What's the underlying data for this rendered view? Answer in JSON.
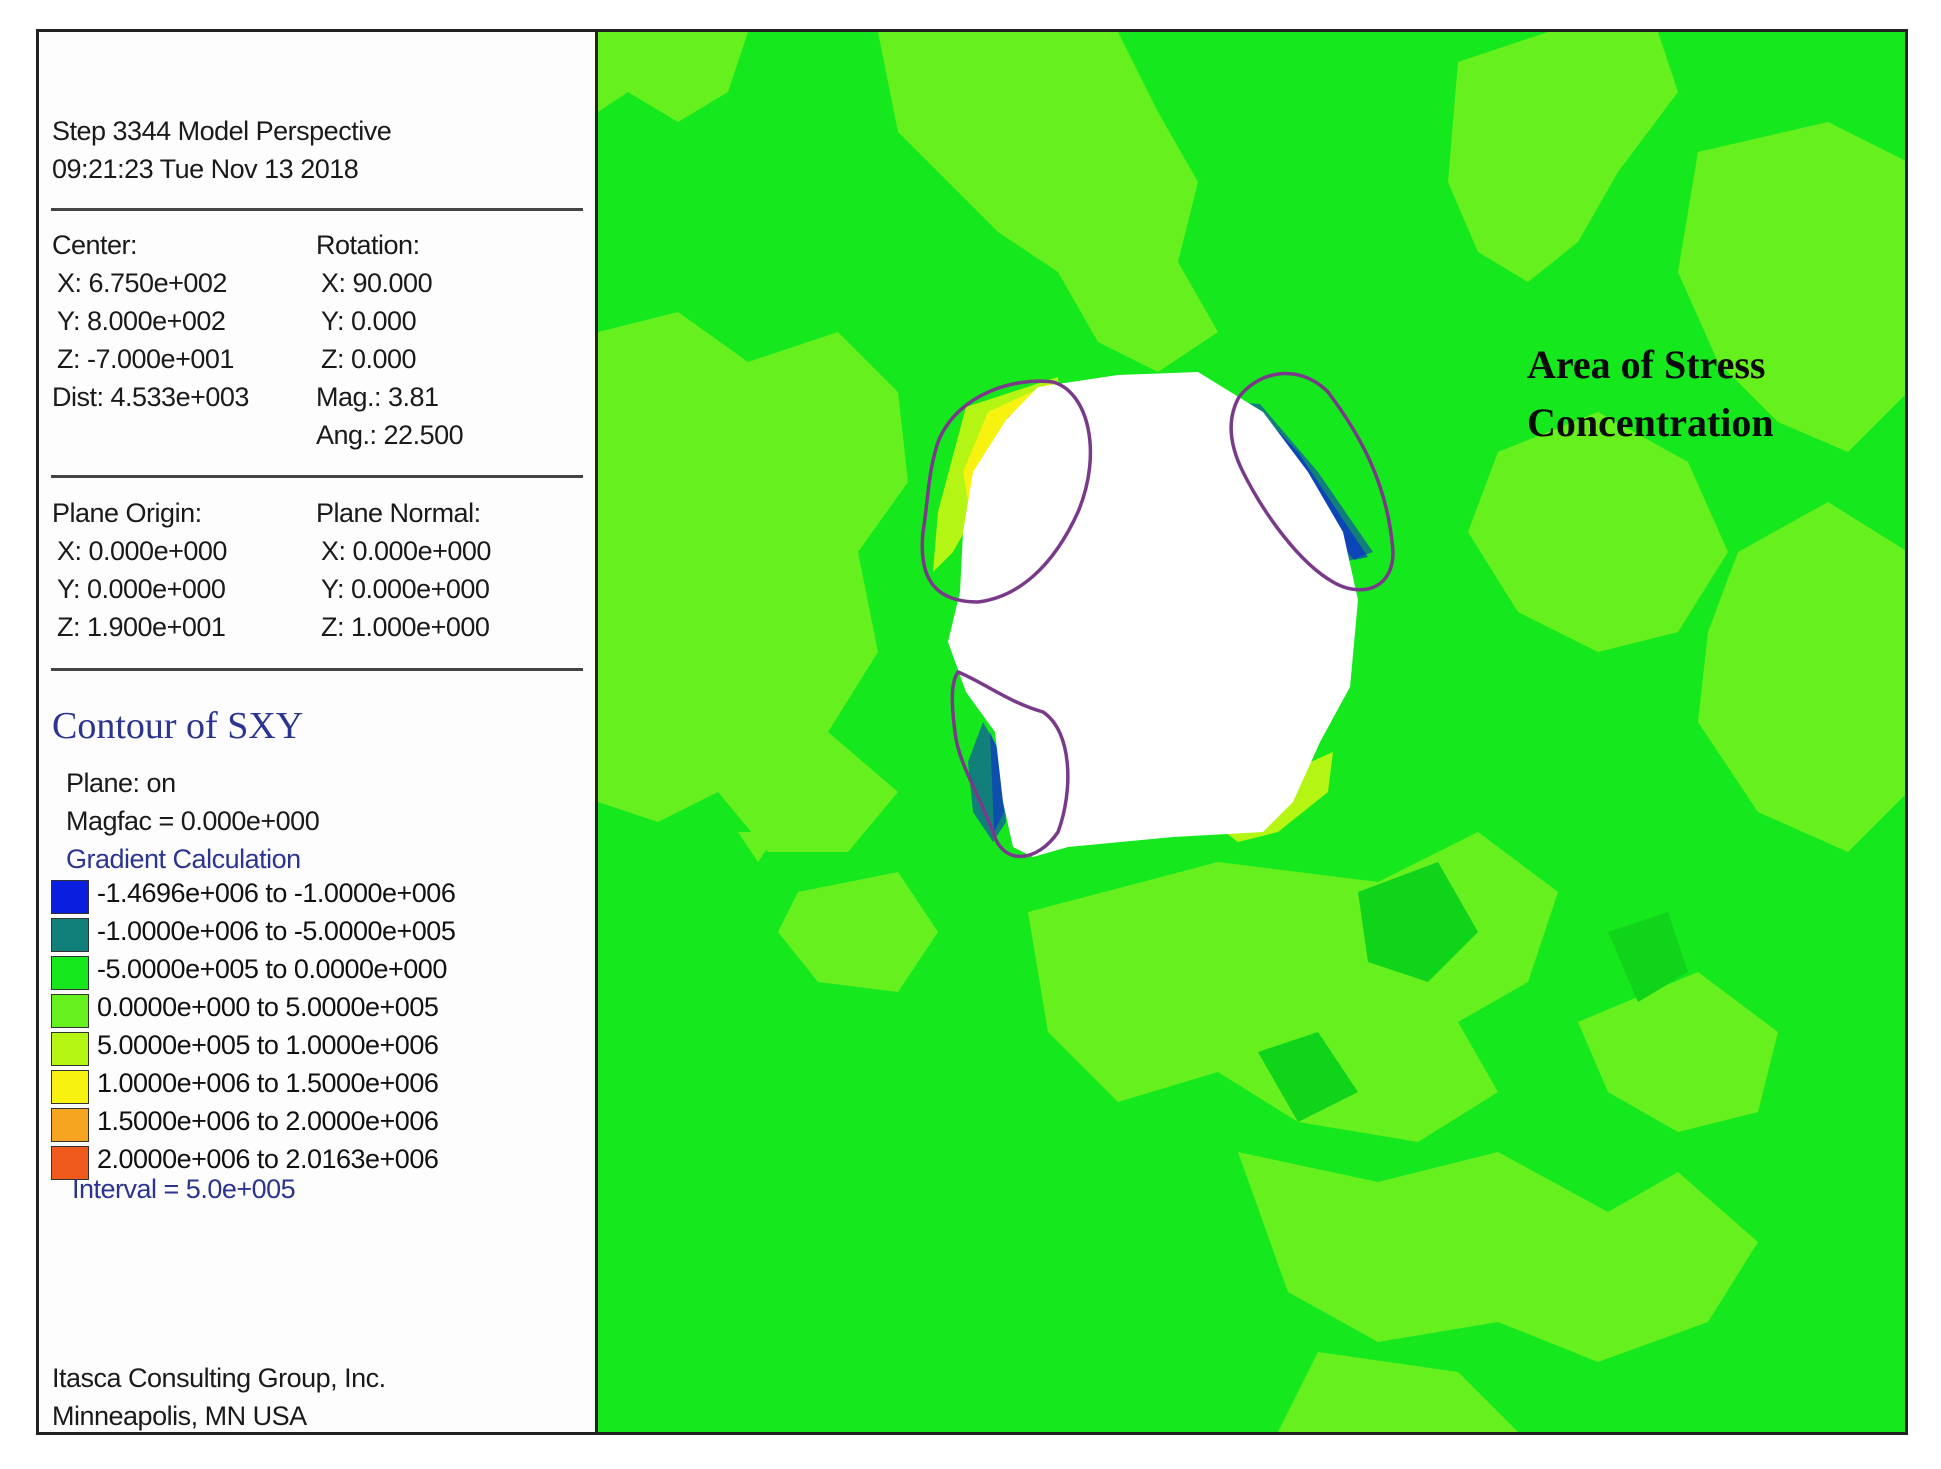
{
  "header": {
    "line1": "Step 3344  Model Perspective",
    "line2": "09:21:23 Tue Nov 13 2018"
  },
  "center": {
    "label": "Center:",
    "x": "X: 6.750e+002",
    "y": "Y: 8.000e+002",
    "z": "Z: -7.000e+001",
    "dist": "Dist: 4.533e+003"
  },
  "rotation": {
    "label": "Rotation:",
    "x": "X:  90.000",
    "y": "Y:   0.000",
    "z": "Z:   0.000",
    "mag": "Mag.:    3.81",
    "ang": "Ang.:  22.500"
  },
  "plane_origin": {
    "label": "Plane Origin:",
    "x": "X: 0.000e+000",
    "y": "Y: 0.000e+000",
    "z": "Z: 1.900e+001"
  },
  "plane_normal": {
    "label": "Plane Normal:",
    "x": "X: 0.000e+000",
    "y": "Y: 0.000e+000",
    "z": "Z: 1.000e+000"
  },
  "contour": {
    "title": "Contour of SXY",
    "plane": "Plane: on",
    "magfac": "Magfac =  0.000e+000",
    "gradient": "Gradient Calculation",
    "legend": [
      {
        "label": "-1.4696e+006 to -1.0000e+006",
        "color": "#0a1ee0"
      },
      {
        "label": "-1.0000e+006 to -5.0000e+005",
        "color": "#12807a"
      },
      {
        "label": "-5.0000e+005 to  0.0000e+000",
        "color": "#16e81e"
      },
      {
        "label": " 0.0000e+000 to  5.0000e+005",
        "color": "#66f01e"
      },
      {
        "label": " 5.0000e+005 to  1.0000e+006",
        "color": "#b4f514"
      },
      {
        "label": " 1.0000e+006 to  1.5000e+006",
        "color": "#f8f210"
      },
      {
        "label": " 1.5000e+006 to  2.0000e+006",
        "color": "#f5a520"
      },
      {
        "label": " 2.0000e+006 to  2.0163e+006",
        "color": "#f05a1c"
      }
    ],
    "interval": "Interval =  5.0e+005"
  },
  "footer": {
    "line1": "Itasca Consulting Group, Inc.",
    "line2": "Minneapolis, MN  USA"
  },
  "annotation": {
    "line1": "Area  of  Stress",
    "line2": "Concentration"
  },
  "colors": {
    "zone_negative_low": "#16e81e",
    "zone_positive_low": "#66f01e",
    "zone_highlight": "#7a3a8a",
    "excavation": "#ffffff"
  }
}
